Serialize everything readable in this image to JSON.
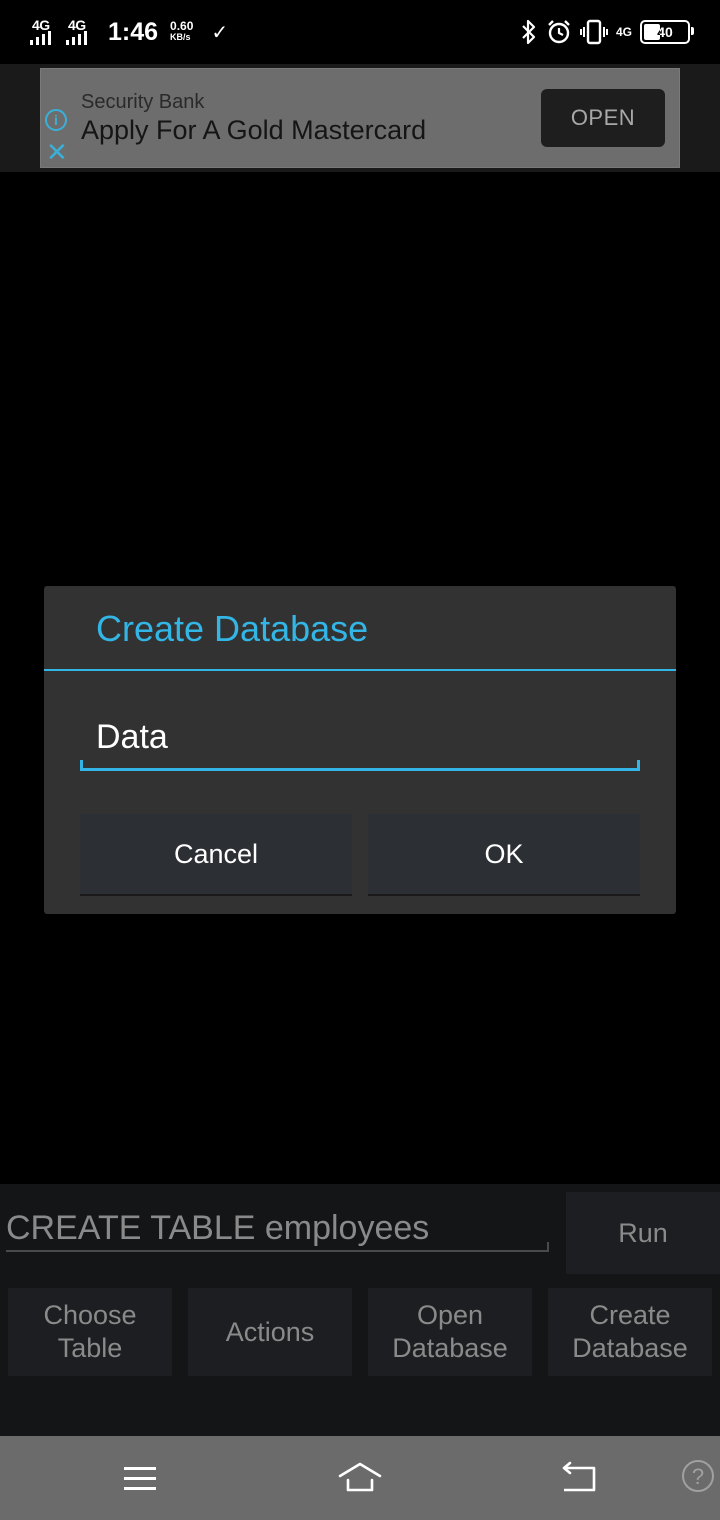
{
  "status_bar": {
    "sim1_label": "4G",
    "sim2_label": "4G",
    "time": "1:46",
    "speed_value": "0.60",
    "speed_unit": "KB/s",
    "network_label": "4G",
    "battery_level": "40",
    "icons": [
      "check-icon",
      "bluetooth-icon",
      "alarm-icon",
      "vibrate-icon"
    ]
  },
  "ad": {
    "advertiser": "Security Bank",
    "headline": "Apply For A Gold Mastercard",
    "cta": "OPEN",
    "info_glyph": "i",
    "close_glyph": "✕",
    "accent_color": "#3ab0d8"
  },
  "dialog": {
    "title": "Create Database",
    "input_value": "Data",
    "cancel_label": "Cancel",
    "ok_label": "OK",
    "accent_color": "#33b5e5"
  },
  "bottom_panel": {
    "sql_value": "CREATE TABLE employees",
    "run_label": "Run",
    "buttons": [
      {
        "line1": "Choose",
        "line2": "Table"
      },
      {
        "line1": "Actions",
        "line2": ""
      },
      {
        "line1": "Open",
        "line2": "Database"
      },
      {
        "line1": "Create",
        "line2": "Database"
      }
    ]
  },
  "nav_bar": {
    "help_glyph": "?"
  }
}
